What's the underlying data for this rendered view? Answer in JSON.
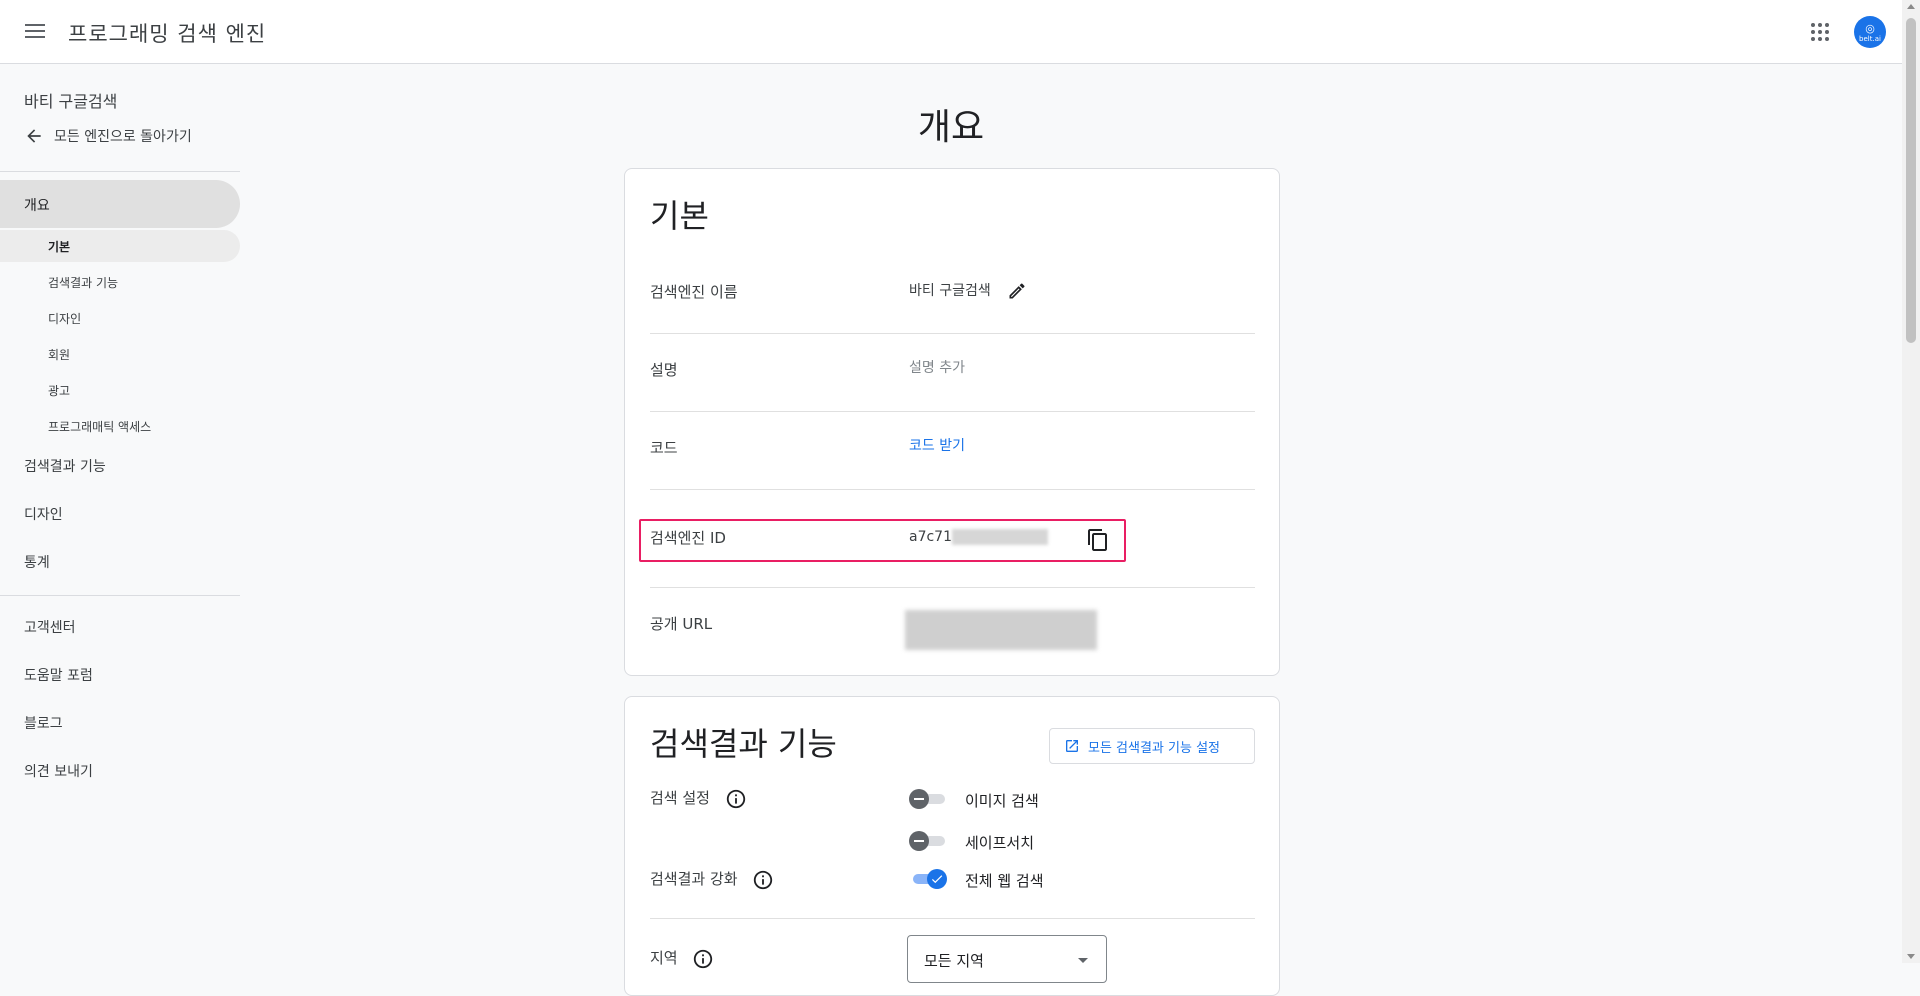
{
  "header": {
    "title": "프로그래밍 검색 엔진",
    "avatar_label": "belt.ai"
  },
  "sidebar": {
    "engine_name": "바티 구글검색",
    "back_label": "모든 엔진으로 돌아가기",
    "overview_label": "개요",
    "sub_items": [
      {
        "label": "기본"
      },
      {
        "label": "검색결과 기능"
      },
      {
        "label": "디자인"
      },
      {
        "label": "회원"
      },
      {
        "label": "광고"
      },
      {
        "label": "프로그래매틱 액세스"
      }
    ],
    "main_items": [
      {
        "label": "검색결과 기능"
      },
      {
        "label": "디자인"
      },
      {
        "label": "통계"
      }
    ],
    "support_items": [
      {
        "label": "고객센터"
      },
      {
        "label": "도움말 포럼"
      },
      {
        "label": "블로그"
      },
      {
        "label": "의견 보내기"
      }
    ]
  },
  "main": {
    "page_title": "개요",
    "basic": {
      "title": "기본",
      "rows": {
        "name": {
          "label": "검색엔진 이름",
          "value": "바티 구글검색"
        },
        "description": {
          "label": "설명",
          "value": "설명 추가"
        },
        "code": {
          "label": "코드",
          "value": "코드 받기"
        },
        "engine_id": {
          "label": "검색엔진 ID",
          "value_prefix": "a7c71"
        },
        "public_url": {
          "label": "공개 URL"
        }
      }
    },
    "search_features": {
      "title": "검색결과 기능",
      "all_settings_button": "모든 검색결과 기능 설정",
      "search_settings_label": "검색 설정",
      "enhance_label": "검색결과 강화",
      "region_label": "지역",
      "toggles": [
        {
          "label": "이미지 검색",
          "on": false
        },
        {
          "label": "세이프서치",
          "on": false
        },
        {
          "label": "전체 웹 검색",
          "on": true
        }
      ],
      "region_value": "모든 지역"
    }
  },
  "colors": {
    "accent": "#1a73e8",
    "highlight": "#e91e63",
    "nav_active": "#e0e0e0"
  }
}
